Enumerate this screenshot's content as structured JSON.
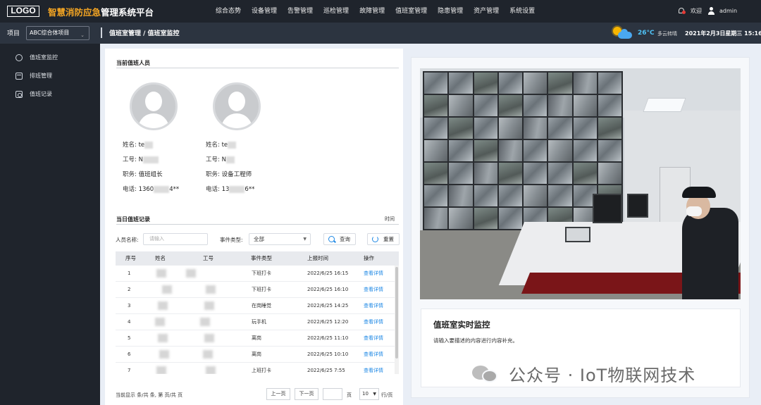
{
  "header": {
    "logo": "LOGO",
    "title_accent": "智慧消防应急",
    "title_rest": "管理系统平台",
    "nav": [
      "综合态势",
      "设备管理",
      "告警管理",
      "巡检管理",
      "故障管理",
      "值班室管理",
      "隐患管理",
      "资产管理",
      "系统设置"
    ],
    "welcome": "欢迎",
    "username": "admin"
  },
  "subbar": {
    "project_label": "项目",
    "project_value": "ABC综合体项目",
    "breadcrumb": "值班室管理 / 值班室监控",
    "temperature": "26°C",
    "weather": "多云转晴",
    "datetime": "2021年2月3日星期三 15:16"
  },
  "sidebar": {
    "items": [
      {
        "label": "值班室监控",
        "icon": "monitor-icon"
      },
      {
        "label": "排班管理",
        "icon": "calendar-icon"
      },
      {
        "label": "值班记录",
        "icon": "record-icon"
      }
    ]
  },
  "duty_staff": {
    "title": "当前值班人员",
    "people": [
      {
        "name_label": "姓名:",
        "name": "te",
        "id_label": "工号:",
        "id": "N",
        "role_label": "职务:",
        "role": "值班组长",
        "phone_label": "电话:",
        "phone_a": "1360",
        "phone_b": "4**"
      },
      {
        "name_label": "姓名:",
        "name": "te",
        "id_label": "工号:",
        "id": "N",
        "role_label": "职务:",
        "role": "设备工程师",
        "phone_label": "电话:",
        "phone_a": "13",
        "phone_b": "6**"
      }
    ]
  },
  "records": {
    "title": "当日值班记录",
    "time_label": "时间",
    "filter": {
      "name_label": "人员名称:",
      "name_placeholder": "请输入",
      "type_label": "事件类型:",
      "type_value": "全部",
      "search": "查询",
      "reset": "重置"
    },
    "columns": [
      "序号",
      "姓名",
      "工号",
      "事件类型",
      "上报时间",
      "操作"
    ],
    "rows": [
      {
        "no": "1",
        "type": "下班打卡",
        "time": "2022/6/25 16:15",
        "action": "查看详情"
      },
      {
        "no": "2",
        "type": "下班打卡",
        "time": "2022/6/25 16:10",
        "action": "查看详情"
      },
      {
        "no": "3",
        "type": "在岗睡觉",
        "time": "2022/6/25 14:25",
        "action": "查看详情"
      },
      {
        "no": "4",
        "type": "玩手机",
        "time": "2022/6/25 12:20",
        "action": "查看详情"
      },
      {
        "no": "5",
        "type": "离岗",
        "time": "2022/6/25 11:10",
        "action": "查看详情"
      },
      {
        "no": "6",
        "type": "离岗",
        "time": "2022/6/25 10:10",
        "action": "查看详情"
      },
      {
        "no": "7",
        "type": "上班打卡",
        "time": "2022/6/25 7:55",
        "action": "查看详情"
      }
    ],
    "pager": {
      "summary": "当前显示  条/共  条, 第  页/共  页",
      "prev": "上一页",
      "next": "下一页",
      "page_unit": "页",
      "page_size": "10",
      "rows_unit": "行/页"
    }
  },
  "realtime": {
    "title": "值班室实时监控",
    "desc": "请输入要描述的内容进行内容补充。"
  },
  "watermark": "公众号 · IoT物联网技术"
}
